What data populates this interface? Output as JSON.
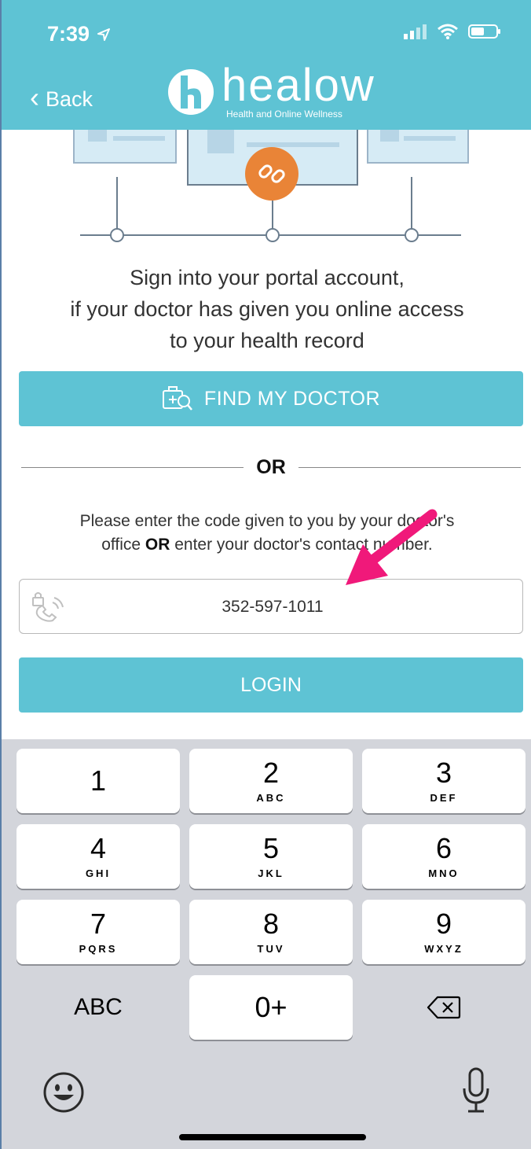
{
  "status_bar": {
    "time": "7:39"
  },
  "header": {
    "back_label": "Back",
    "logo_text": "healow",
    "logo_tagline": "Health and Online Wellness",
    "bg_color": "#5ec3d4"
  },
  "intro_text_line1": "Sign into your portal account,",
  "intro_text_line2": "if your doctor has given you online access",
  "intro_text_line3": "to your health record",
  "find_doctor_label": "FIND MY DOCTOR",
  "or_label": "OR",
  "instruction": {
    "line1": "Please enter the code given to you by your doctor's",
    "line2_start": "office ",
    "line2_bold": "OR",
    "line2_end": " enter your doctor's contact number."
  },
  "code_input_value": "352-597-1011",
  "login_label": "LOGIN",
  "annotation_arrow_color": "#f0197a",
  "keypad": {
    "keys": [
      {
        "digit": "1",
        "letters": ""
      },
      {
        "digit": "2",
        "letters": "ABC"
      },
      {
        "digit": "3",
        "letters": "DEF"
      },
      {
        "digit": "4",
        "letters": "GHI"
      },
      {
        "digit": "5",
        "letters": "JKL"
      },
      {
        "digit": "6",
        "letters": "MNO"
      },
      {
        "digit": "7",
        "letters": "PQRS"
      },
      {
        "digit": "8",
        "letters": "TUV"
      },
      {
        "digit": "9",
        "letters": "WXYZ"
      }
    ],
    "abc_label": "ABC",
    "zero_label": "0+"
  },
  "icons": [
    "location-arrow-icon",
    "signal-icon",
    "wifi-icon",
    "battery-icon",
    "back-chevron-icon",
    "healow-logo-icon",
    "link-icon",
    "find-doctor-icon",
    "phone-lock-icon",
    "delete-icon",
    "emoji-icon",
    "mic-icon"
  ]
}
